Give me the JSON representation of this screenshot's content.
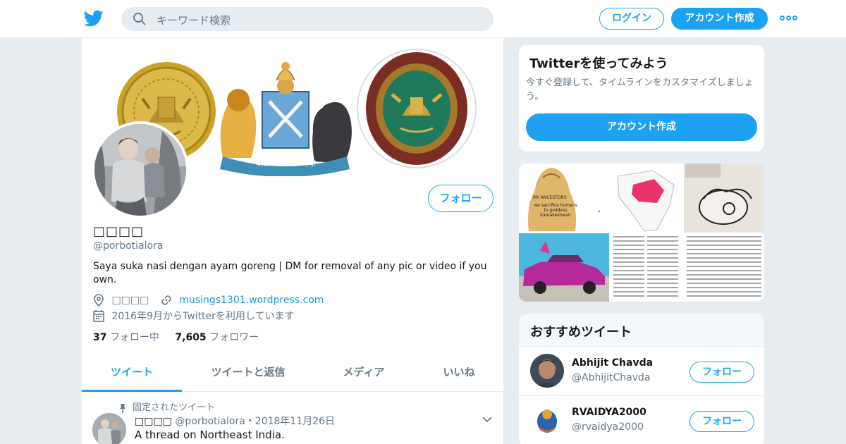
{
  "search": {
    "placeholder": "キーワード検索"
  },
  "nav": {
    "login_label": "ログイン",
    "signup_label": "アカウント作成"
  },
  "profile": {
    "display_name": "□□□□",
    "handle": "@porbotialora",
    "bio": "Saya suka nasi dengan ayam goreng | DM for removal of any pic or video if you own.",
    "location": "□□□□",
    "website": "musings1301.wordpress.com",
    "joined": "2016年9月からTwitterを利用しています",
    "following_count": "37",
    "following_label": "フォロー中",
    "followers_count": "7,605",
    "followers_label": "フォロワー",
    "follow_label": "フォロー",
    "banner_motto": "यतो धर्मस्ततो जयः"
  },
  "tabs": [
    {
      "label": "ツイート",
      "active": true
    },
    {
      "label": "ツイートと返信"
    },
    {
      "label": "メディア"
    },
    {
      "label": "いいね"
    }
  ],
  "pinned_tweet": {
    "pinned_label": "固定されたツイート",
    "author_name": "□□□□",
    "author_handle": "@porbotialora",
    "date": "・2018年11月26日",
    "text": "A thread on Northeast India."
  },
  "signup_card": {
    "title": "Twitterを使ってみよう",
    "description": "今すぐ登録して、タイムラインをカスタマイズしましょう。",
    "button_label": "アカウント作成"
  },
  "media_grid": {
    "meme_text_1": "MY ANCESTORS",
    "meme_text_2": "we sacrifice humans to goddess Kamakeshwari",
    "separator": ","
  },
  "recommended": {
    "title": "おすすめツイート",
    "users": [
      {
        "name": "Abhijit Chavda",
        "handle": "@AbhijitChavda",
        "follow_label": "フォロー"
      },
      {
        "name": "RVAIDYA2000",
        "handle": "@rvaidya2000",
        "follow_label": "フォロー"
      }
    ]
  },
  "colors": {
    "accent": "#1da1f2",
    "text": "#14171a",
    "secondary": "#657786",
    "background": "#e6ecf0"
  },
  "icons": [
    "twitter-bird-icon",
    "search-icon",
    "more-icon",
    "location-icon",
    "link-icon",
    "calendar-icon",
    "pin-icon",
    "chevron-down-icon"
  ]
}
